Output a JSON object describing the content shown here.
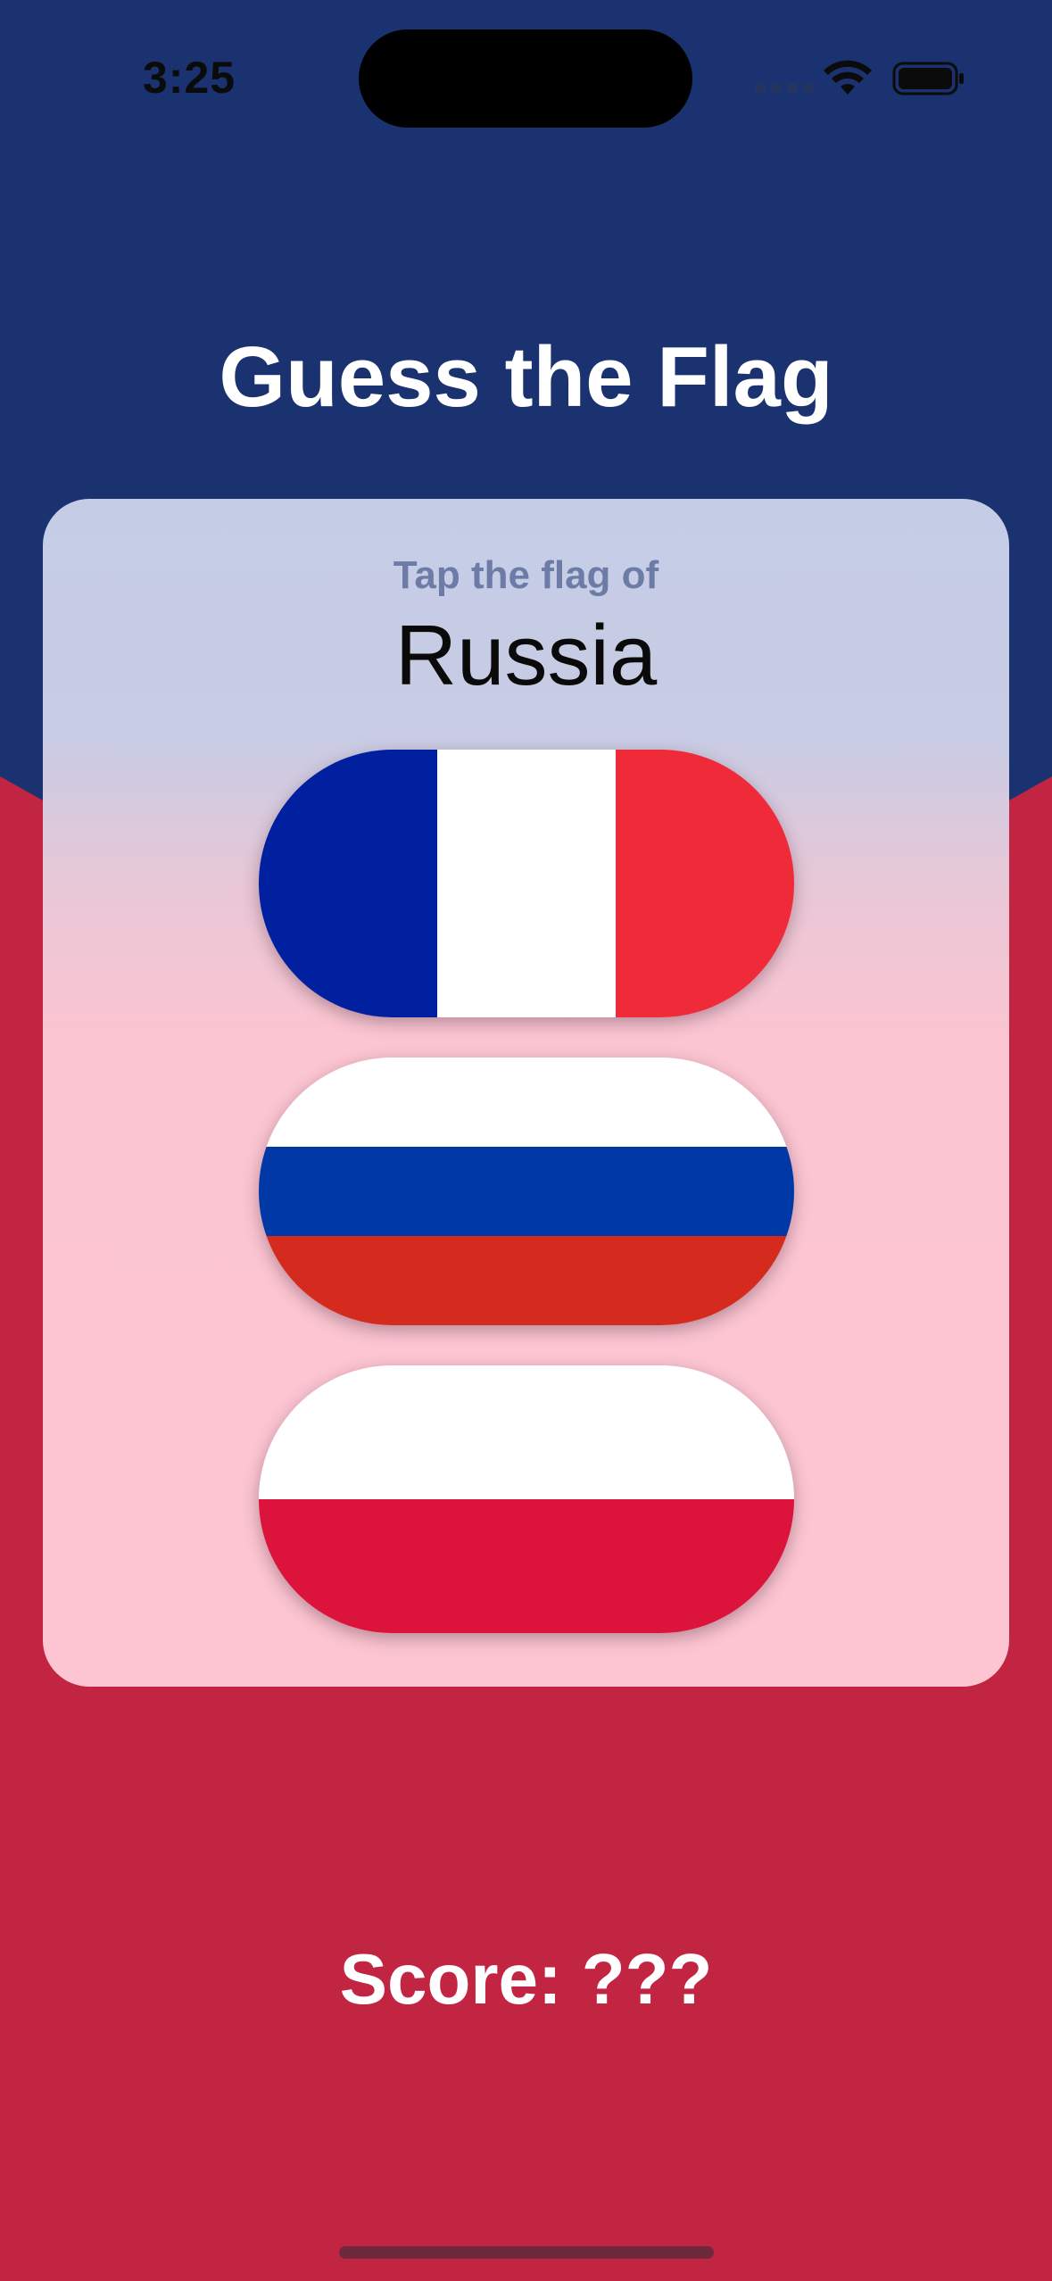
{
  "status_bar": {
    "time": "3:25",
    "icons": [
      "signal-icon",
      "wifi-icon",
      "battery-icon"
    ]
  },
  "title": "Guess the Flag",
  "card": {
    "subtitle": "Tap the flag of",
    "country": "Russia"
  },
  "flags": [
    {
      "country": "France",
      "colors": [
        "#00209F",
        "#FFFFFF",
        "#EF2B3A"
      ]
    },
    {
      "country": "Russia",
      "colors": [
        "#FFFFFF",
        "#0039A6",
        "#D52B1E"
      ]
    },
    {
      "country": "Poland",
      "colors": [
        "#FFFFFF",
        "#DC143C"
      ]
    }
  ],
  "score": "Score: ???",
  "colors": {
    "background_top": "#1B3270",
    "background_bottom": "#C22542",
    "card_top": "#C5CDE6",
    "card_bottom": "#FCC5D1"
  }
}
